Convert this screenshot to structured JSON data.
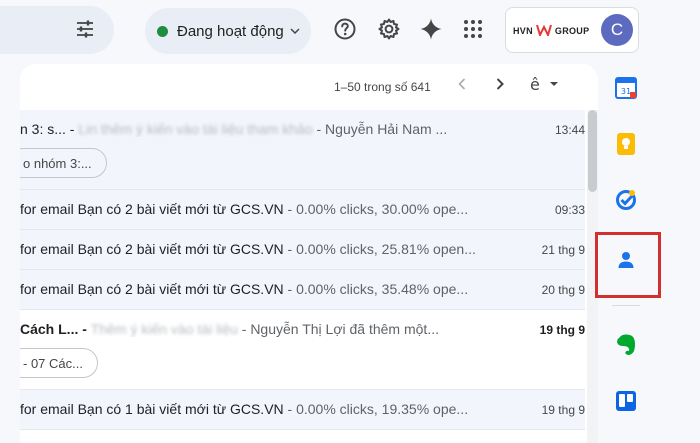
{
  "header": {
    "status_label": "Đang hoạt động",
    "status_color": "#1e8e3e",
    "icons": [
      "tune-icon",
      "help-icon",
      "settings-icon",
      "gemini-sparkle-icon",
      "apps-grid-icon"
    ],
    "account": {
      "brand_left": "HVN",
      "brand_right": "GROUP",
      "avatar_letter": "C",
      "avatar_color": "#5c6bc0"
    }
  },
  "toolbar": {
    "page_count": "1–50 trong số 641"
  },
  "emails": [
    {
      "subject": "n 3: s... - ",
      "blurred": "Lin thêm ý kiến vào tài liệu tham khảo",
      "snippet": " - Nguyễn Hải Nam ...",
      "date": "13:44",
      "chip": "o nhóm 3:...",
      "read": true
    },
    {
      "subject": "for email Bạn có 2 bài viết mới từ GCS.VN",
      "blurred": "",
      "snippet": " - 0.00% clicks, 30.00% ope...",
      "date": "09:33",
      "read": true
    },
    {
      "subject": "for email Bạn có 2 bài viết mới từ GCS.VN",
      "blurred": "",
      "snippet": " - 0.00% clicks, 25.81% open...",
      "date": "21 thg 9",
      "read": true
    },
    {
      "subject": "for email Bạn có 2 bài viết mới từ GCS.VN",
      "blurred": "",
      "snippet": " - 0.00% clicks, 35.48% ope...",
      "date": "20 thg 9",
      "read": true
    },
    {
      "subject": "Cách L... - ",
      "blurred": "Thêm ý kiến vào tài liệu",
      "snippet": " - Nguyễn Thị Lợi đã thêm một...",
      "date": "19 thg 9",
      "chip": "- 07 Các...",
      "read": false
    },
    {
      "subject": "for email Bạn có 1 bài viết mới từ GCS.VN",
      "blurred": "",
      "snippet": " - 0.00% clicks, 19.35% ope...",
      "date": "19 thg 9",
      "read": true
    }
  ],
  "rail": {
    "icons": [
      "calendar-icon",
      "keep-icon",
      "tasks-icon",
      "contacts-icon",
      "evernote-icon",
      "trello-icon"
    ],
    "calendar_day": "31",
    "highlight_color": "#d32f2f"
  }
}
